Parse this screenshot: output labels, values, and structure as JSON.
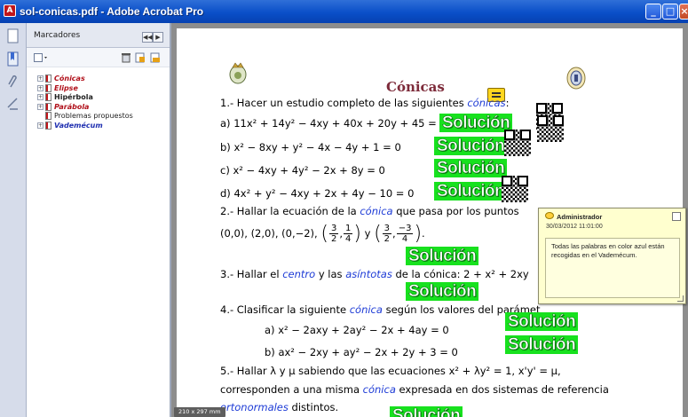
{
  "window": {
    "title": "sol-conicas.pdf - Adobe Acrobat Pro",
    "app_icon": "acrobat-icon"
  },
  "bookmarks": {
    "header": "Marcadores",
    "items": [
      {
        "label": "Cónicas",
        "style": "red",
        "expandable": true
      },
      {
        "label": "Elipse",
        "style": "red",
        "expandable": true
      },
      {
        "label": "Hipérbola",
        "style": "bold",
        "expandable": true
      },
      {
        "label": "Parábola",
        "style": "red",
        "expandable": true
      },
      {
        "label": "Problemas propuestos",
        "style": "plain",
        "expandable": false
      },
      {
        "label": "Vademécum",
        "style": "blue",
        "expandable": true
      }
    ]
  },
  "document": {
    "title": "Cónicas",
    "q1": {
      "text": "1.- Hacer un estudio completo de las siguientes ",
      "kw": "cónicas",
      "tail": ":"
    },
    "eq_a": "a) 11x² + 14y² − 4xy + 40x + 20y + 45 = 0",
    "eq_b": "b) x² − 8xy + y² − 4x − 4y + 1 = 0",
    "eq_c": "c) x² − 4xy + 4y² − 2x + 8y = 0",
    "eq_d": "d) 4x² + y² − 4xy + 2x + 4y − 10 = 0",
    "q2": {
      "text": "2.- Hallar la ecuación de la ",
      "kw": "cónica",
      "tail": " que pasa por los puntos"
    },
    "q2_points": "(0,0),  (2,0),  (0,−2),",
    "frac1": {
      "num1": "3",
      "den1": "2",
      "num2": "1",
      "den2": "4"
    },
    "frac2": {
      "num1": "3",
      "den1": "2",
      "num2": "−3",
      "den2": "4"
    },
    "q2_y": "y",
    "q3": {
      "a": "3.- Hallar el ",
      "kw1": "centro",
      "b": " y las ",
      "kw2": "asíntotas",
      "c": " de la cónica: 2 + x² + 2xy"
    },
    "q4": {
      "a": "4.- Clasificar la siguiente ",
      "kw": "cónica",
      "b": " según los valores del parámet"
    },
    "q4_a": "a) x² − 2axy + 2ay² − 2x + 4ay = 0",
    "q4_b": "b) ax² − 2xy + ay² − 2x + 2y + 3 = 0",
    "q5_line1": "5.- Hallar λ y μ sabiendo que las ecuaciones  x² + λy² = 1,  x'y' = μ,",
    "q5_line2": {
      "a": "corresponden a una misma ",
      "kw": "cónica",
      "b": " expresada en dos sistemas de referencia"
    },
    "q5_line3": {
      "kw": "ortonormales",
      "b": " distintos."
    },
    "solution_label": "Solución"
  },
  "comment": {
    "author": "Administrador",
    "date": "30/03/2012 11:01:00",
    "body": "Todas las palabras en color azul están recogidas en el Vademécum."
  },
  "page_size": "210 x 297 mm",
  "colors": {
    "solution_green": "#17e11e",
    "keyword_blue": "#1d3bd6",
    "title_maroon": "#7d2b3a"
  }
}
